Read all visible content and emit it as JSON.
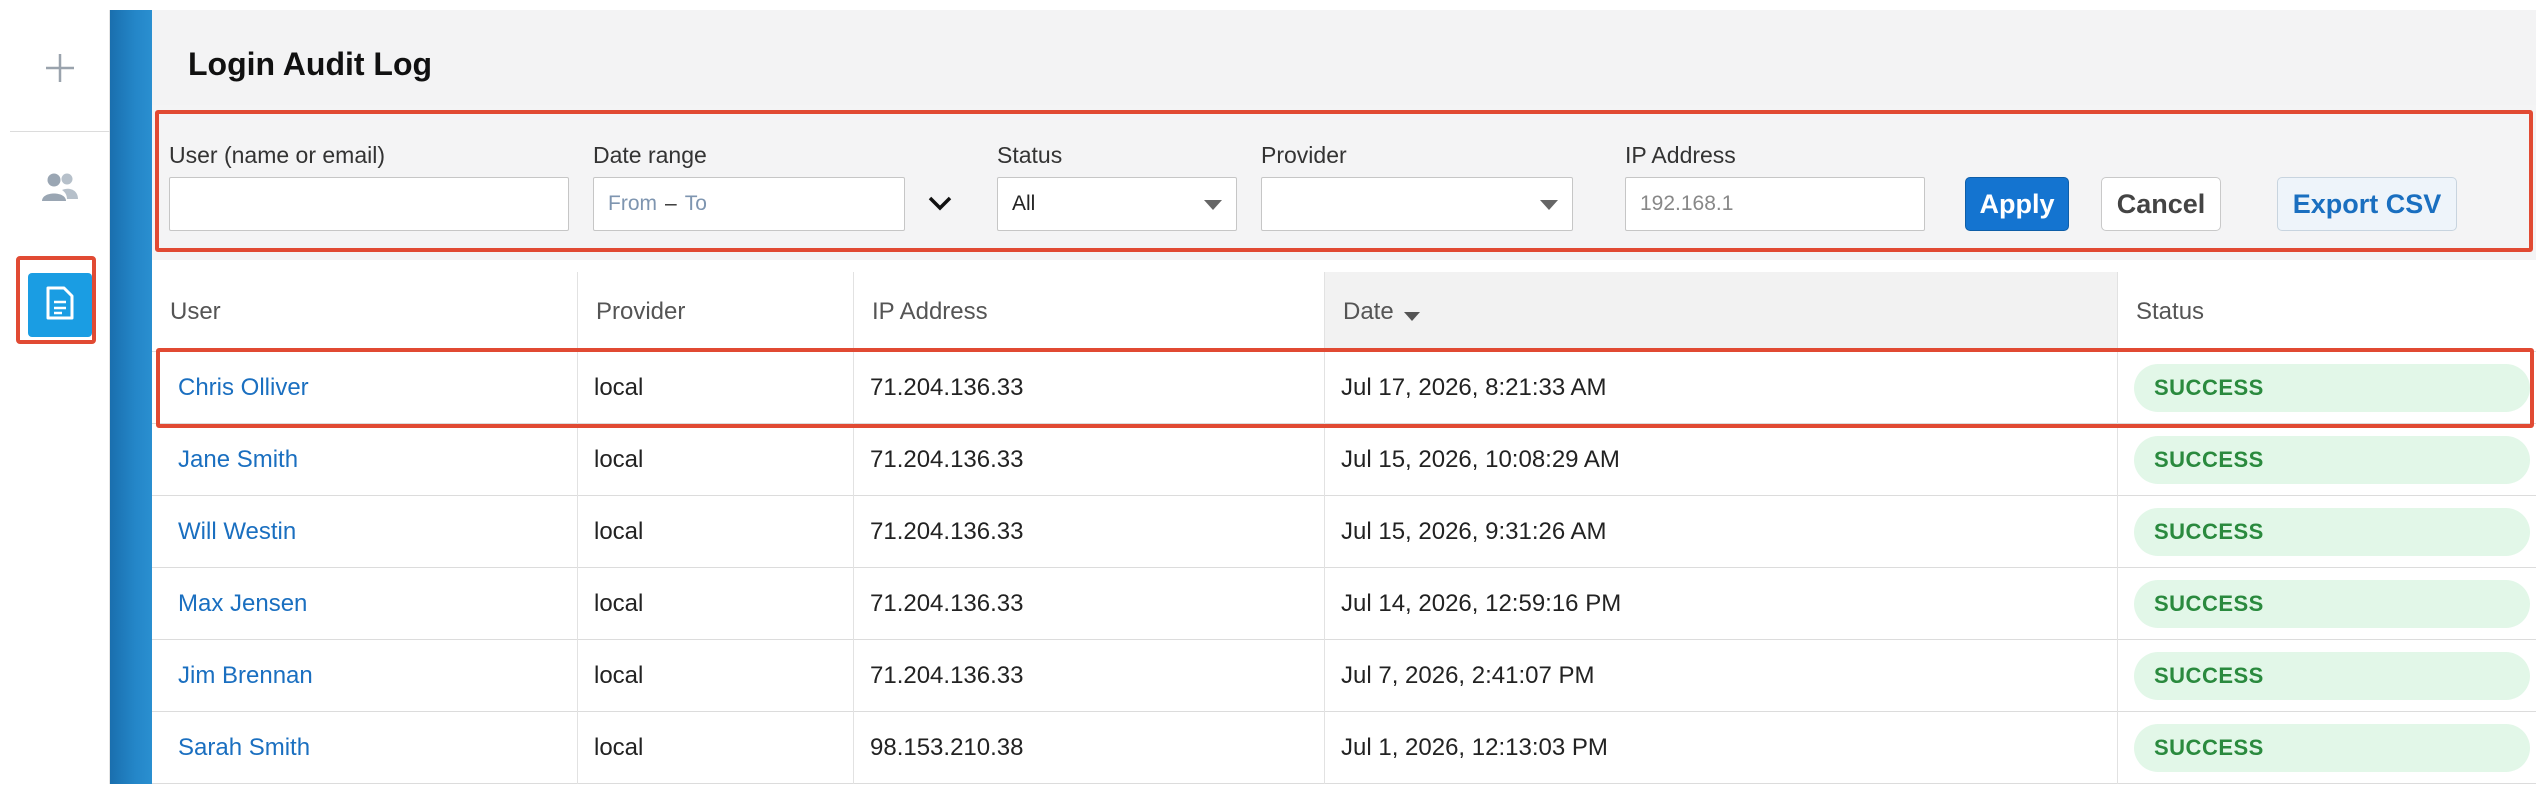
{
  "sidebar": {
    "items": [
      {
        "icon": "plus-icon"
      },
      {
        "icon": "users-icon"
      },
      {
        "icon": "document-icon",
        "active": true
      }
    ],
    "active_color": "#1a9de3"
  },
  "page": {
    "title": "Login Audit Log"
  },
  "filters": {
    "user_label": "User (name or email)",
    "user_value": "",
    "date_label": "Date range",
    "date_from_placeholder": "From",
    "date_separator": "–",
    "date_to_placeholder": "To",
    "status_label": "Status",
    "status_value": "All",
    "provider_label": "Provider",
    "provider_value": "",
    "ip_label": "IP Address",
    "ip_placeholder": "192.168.1",
    "apply_label": "Apply",
    "cancel_label": "Cancel",
    "export_label": "Export CSV"
  },
  "table": {
    "columns": [
      "User",
      "Provider",
      "IP Address",
      "Date",
      "Status"
    ],
    "sorted_column": "Date",
    "rows": [
      {
        "user": "Chris Olliver",
        "provider": "local",
        "ip": "71.204.136.33",
        "date": "Jul 17, 2026, 8:21:33 AM",
        "status": "SUCCESS"
      },
      {
        "user": "Jane Smith",
        "provider": "local",
        "ip": "71.204.136.33",
        "date": "Jul 15, 2026, 10:08:29 AM",
        "status": "SUCCESS"
      },
      {
        "user": "Will Westin",
        "provider": "local",
        "ip": "71.204.136.33",
        "date": "Jul 15, 2026, 9:31:26 AM",
        "status": "SUCCESS"
      },
      {
        "user": "Max Jensen",
        "provider": "local",
        "ip": "71.204.136.33",
        "date": "Jul 14, 2026, 12:59:16 PM",
        "status": "SUCCESS"
      },
      {
        "user": "Jim Brennan",
        "provider": "local",
        "ip": "71.204.136.33",
        "date": "Jul 7, 2026, 2:41:07 PM",
        "status": "SUCCESS"
      },
      {
        "user": "Sarah Smith",
        "provider": "local",
        "ip": "98.153.210.38",
        "date": "Jul 1, 2026, 12:13:03 PM",
        "status": "SUCCESS"
      }
    ]
  },
  "colors": {
    "accent": "#1474d0",
    "link": "#1a6fc0",
    "success_bg": "#e2f7e8",
    "success_text": "#2a8a3e",
    "highlight": "#e14a33"
  }
}
